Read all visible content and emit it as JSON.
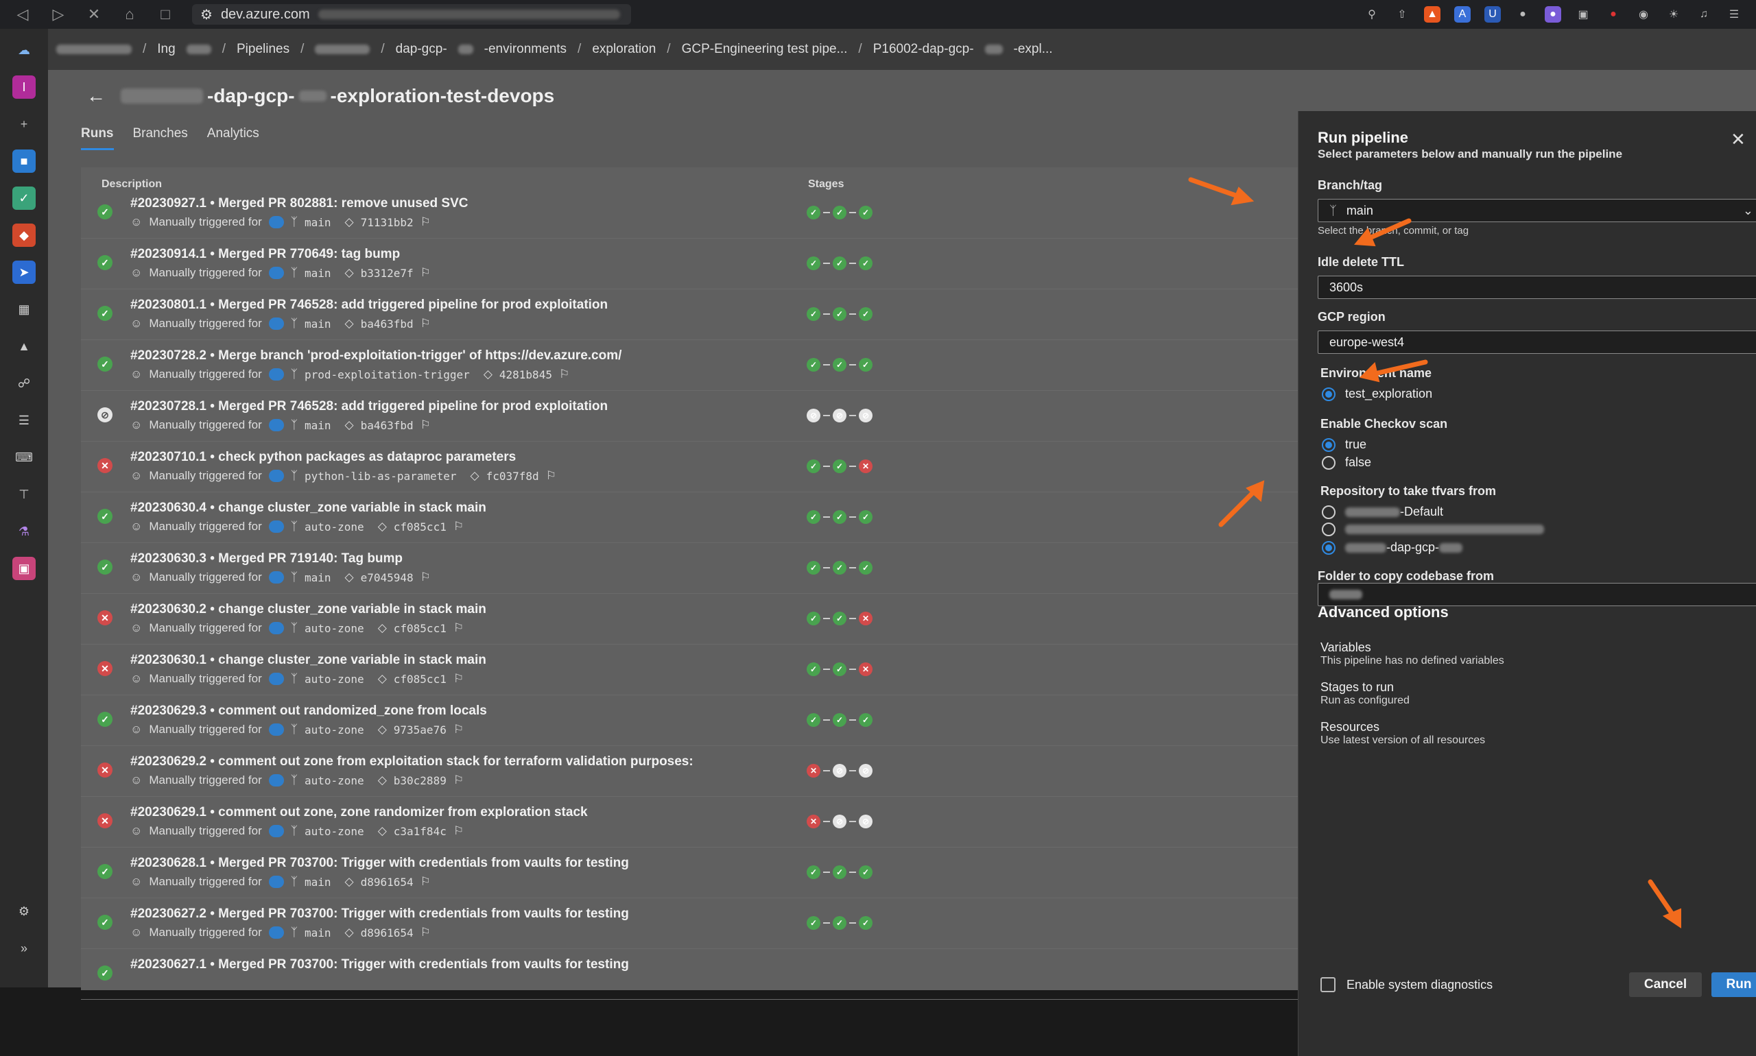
{
  "browser": {
    "url": "dev.azure.com"
  },
  "breadcrumb": {
    "items": [
      "Ing",
      "Pipelines",
      "dap-gcp-",
      "-environments",
      "exploration",
      "GCP-Engineering test pipe...",
      "P16002-dap-gcp-",
      "-expl..."
    ]
  },
  "page": {
    "title": "-dap-gcp-",
    "title_suffix": "-exploration-test-devops",
    "tabs": [
      "Runs",
      "Branches",
      "Analytics"
    ],
    "col_description": "Description",
    "col_stages": "Stages"
  },
  "runs": [
    {
      "status": "ok",
      "title": "#20230927.1 • Merged PR 802881: remove unused SVC",
      "trigger": "Manually triggered for",
      "branch": "main",
      "commit": "71131bb2",
      "stages": [
        "ok",
        "ok",
        "ok"
      ]
    },
    {
      "status": "ok",
      "title": "#20230914.1 • Merged PR 770649: tag bump",
      "trigger": "Manually triggered for",
      "branch": "main",
      "commit": "b3312e7f",
      "stages": [
        "ok",
        "ok",
        "ok"
      ]
    },
    {
      "status": "ok",
      "title": "#20230801.1 • Merged PR 746528: add triggered pipeline for prod exploitation",
      "trigger": "Manually triggered for",
      "branch": "main",
      "commit": "ba463fbd",
      "stages": [
        "ok",
        "ok",
        "ok"
      ]
    },
    {
      "status": "ok",
      "title": "#20230728.2 • Merge branch 'prod-exploitation-trigger' of https://dev.azure.com/",
      "trigger": "Manually triggered for",
      "branch": "prod-exploitation-trigger",
      "commit": "4281b845",
      "stages": [
        "ok",
        "ok",
        "ok"
      ]
    },
    {
      "status": "cancel",
      "title": "#20230728.1 • Merged PR 746528: add triggered pipeline for prod exploitation",
      "trigger": "Manually triggered for",
      "branch": "main",
      "commit": "ba463fbd",
      "stages": [
        "cancel",
        "cancel",
        "cancel"
      ]
    },
    {
      "status": "fail",
      "title": "#20230710.1 • check python packages as dataproc parameters",
      "trigger": "Manually triggered for",
      "branch": "python-lib-as-parameter",
      "commit": "fc037f8d",
      "stages": [
        "ok",
        "ok",
        "fail"
      ]
    },
    {
      "status": "ok",
      "title": "#20230630.4 • change cluster_zone variable in stack main",
      "trigger": "Manually triggered for",
      "branch": "auto-zone",
      "commit": "cf085cc1",
      "stages": [
        "ok",
        "ok",
        "ok"
      ]
    },
    {
      "status": "ok",
      "title": "#20230630.3 • Merged PR 719140: Tag bump",
      "trigger": "Manually triggered for",
      "branch": "main",
      "commit": "e7045948",
      "stages": [
        "ok",
        "ok",
        "ok"
      ]
    },
    {
      "status": "fail",
      "title": "#20230630.2 • change cluster_zone variable in stack main",
      "trigger": "Manually triggered for",
      "branch": "auto-zone",
      "commit": "cf085cc1",
      "stages": [
        "ok",
        "ok",
        "fail"
      ]
    },
    {
      "status": "fail",
      "title": "#20230630.1 • change cluster_zone variable in stack main",
      "trigger": "Manually triggered for",
      "branch": "auto-zone",
      "commit": "cf085cc1",
      "stages": [
        "ok",
        "ok",
        "fail"
      ]
    },
    {
      "status": "ok",
      "title": "#20230629.3 • comment out randomized_zone from locals",
      "trigger": "Manually triggered for",
      "branch": "auto-zone",
      "commit": "9735ae76",
      "stages": [
        "ok",
        "ok",
        "ok"
      ]
    },
    {
      "status": "fail",
      "title": "#20230629.2 • comment out zone from exploitation stack for terraform validation purposes:",
      "trigger": "Manually triggered for",
      "branch": "auto-zone",
      "commit": "b30c2889",
      "stages": [
        "fail",
        "cancel",
        "cancel"
      ]
    },
    {
      "status": "fail",
      "title": "#20230629.1 • comment out zone, zone randomizer from exploration stack",
      "trigger": "Manually triggered for",
      "branch": "auto-zone",
      "commit": "c3a1f84c",
      "stages": [
        "fail",
        "cancel",
        "cancel"
      ]
    },
    {
      "status": "ok",
      "title": "#20230628.1 • Merged PR 703700: Trigger with credentials from vaults for testing",
      "trigger": "Manually triggered for",
      "branch": "main",
      "commit": "d8961654",
      "stages": [
        "ok",
        "ok",
        "ok"
      ]
    },
    {
      "status": "ok",
      "title": "#20230627.2 • Merged PR 703700: Trigger with credentials from vaults for testing",
      "trigger": "Manually triggered for",
      "branch": "main",
      "commit": "d8961654",
      "stages": [
        "ok",
        "ok",
        "ok"
      ]
    },
    {
      "status": "ok",
      "title": "#20230627.1 • Merged PR 703700: Trigger with credentials from vaults for testing",
      "trigger": "",
      "branch": "",
      "commit": "",
      "stages": []
    }
  ],
  "run_panel": {
    "title": "Run pipeline",
    "subtitle": "Select parameters below and manually run the pipeline",
    "branch_label": "Branch/tag",
    "branch_value": "main",
    "branch_hint": "Select the branch, commit, or tag",
    "ttl_label": "Idle delete TTL",
    "ttl_value": "3600s",
    "region_label": "GCP region",
    "region_value": "europe-west4",
    "env_label": "Environment name",
    "env_option": "test_exploration",
    "checkov_label": "Enable Checkov scan",
    "checkov_true": "true",
    "checkov_false": "false",
    "repo_label": "Repository to take tfvars from",
    "repo_options": [
      "-Default",
      "",
      "-dap-gcp-"
    ],
    "folder_label": "Folder to copy codebase from",
    "advanced_title": "Advanced options",
    "variables_title": "Variables",
    "variables_sub": "This pipeline has no defined variables",
    "stages_title": "Stages to run",
    "stages_sub": "Run as configured",
    "resources_title": "Resources",
    "resources_sub": "Use latest version of all resources",
    "diagnostics_label": "Enable system diagnostics",
    "cancel_label": "Cancel",
    "run_label": "Run"
  },
  "colors": {
    "accent": "#2f7ecb",
    "success": "#49a34f",
    "failure": "#d24b4b",
    "annotation": "#f26b1d"
  }
}
